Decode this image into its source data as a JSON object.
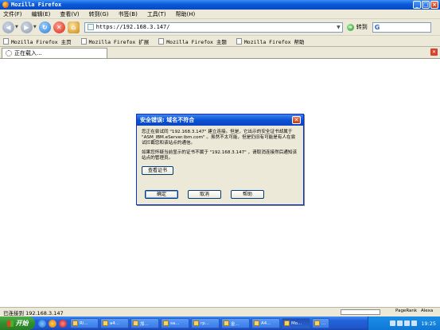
{
  "window": {
    "title": "Mozilla Firefox"
  },
  "menu": [
    "文件(F)",
    "编辑(E)",
    "查看(V)",
    "转到(G)",
    "书签(B)",
    "工具(T)",
    "帮助(H)"
  ],
  "nav": {
    "url": "https://192.168.3.147/",
    "go_label": "转到",
    "search_icon": "G"
  },
  "bookmarks": [
    "Mozilla Firefox 主页",
    "Mozilla Firefox 扩展",
    "Mozilla Firefox 主题",
    "Mozilla Firefox 帮助"
  ],
  "tab": {
    "label": "正在载入..."
  },
  "dialog": {
    "title": "安全错误: 域名不符合",
    "para1": "您正在尝试同 \"192.168.3.147\" 建立连接。但是，它出示的安全证书却属于 \"ASM_IBM.eServer.ibm.com\" 。虽然不太可能，但是仍旧有可能是有人在尝试拦截您和该站点的通信。",
    "para2": "如果您怀疑当前显示的证书不属于 \"192.168.3.147\" ，请取消连接然后通知该站点的管理员。",
    "view_cert": "查看证书",
    "ok": "确定",
    "cancel": "取消",
    "help": "帮助"
  },
  "status": {
    "text": "已连接到 192.168.3.147",
    "pagerank": "PageRank",
    "alexa": "Alexa"
  },
  "taskbar": {
    "start": "开始",
    "tasks": [
      "Ri...",
      "a4...",
      "加...",
      "sa...",
      "rp...",
      "金...",
      "A4...",
      "Mo...",
      "..."
    ],
    "clock": "19:25"
  },
  "colors": {
    "titlebar": "#0a5ad8",
    "chrome": "#ece9d8",
    "taskbar": "#2462d8",
    "start": "#2f8f2e"
  }
}
